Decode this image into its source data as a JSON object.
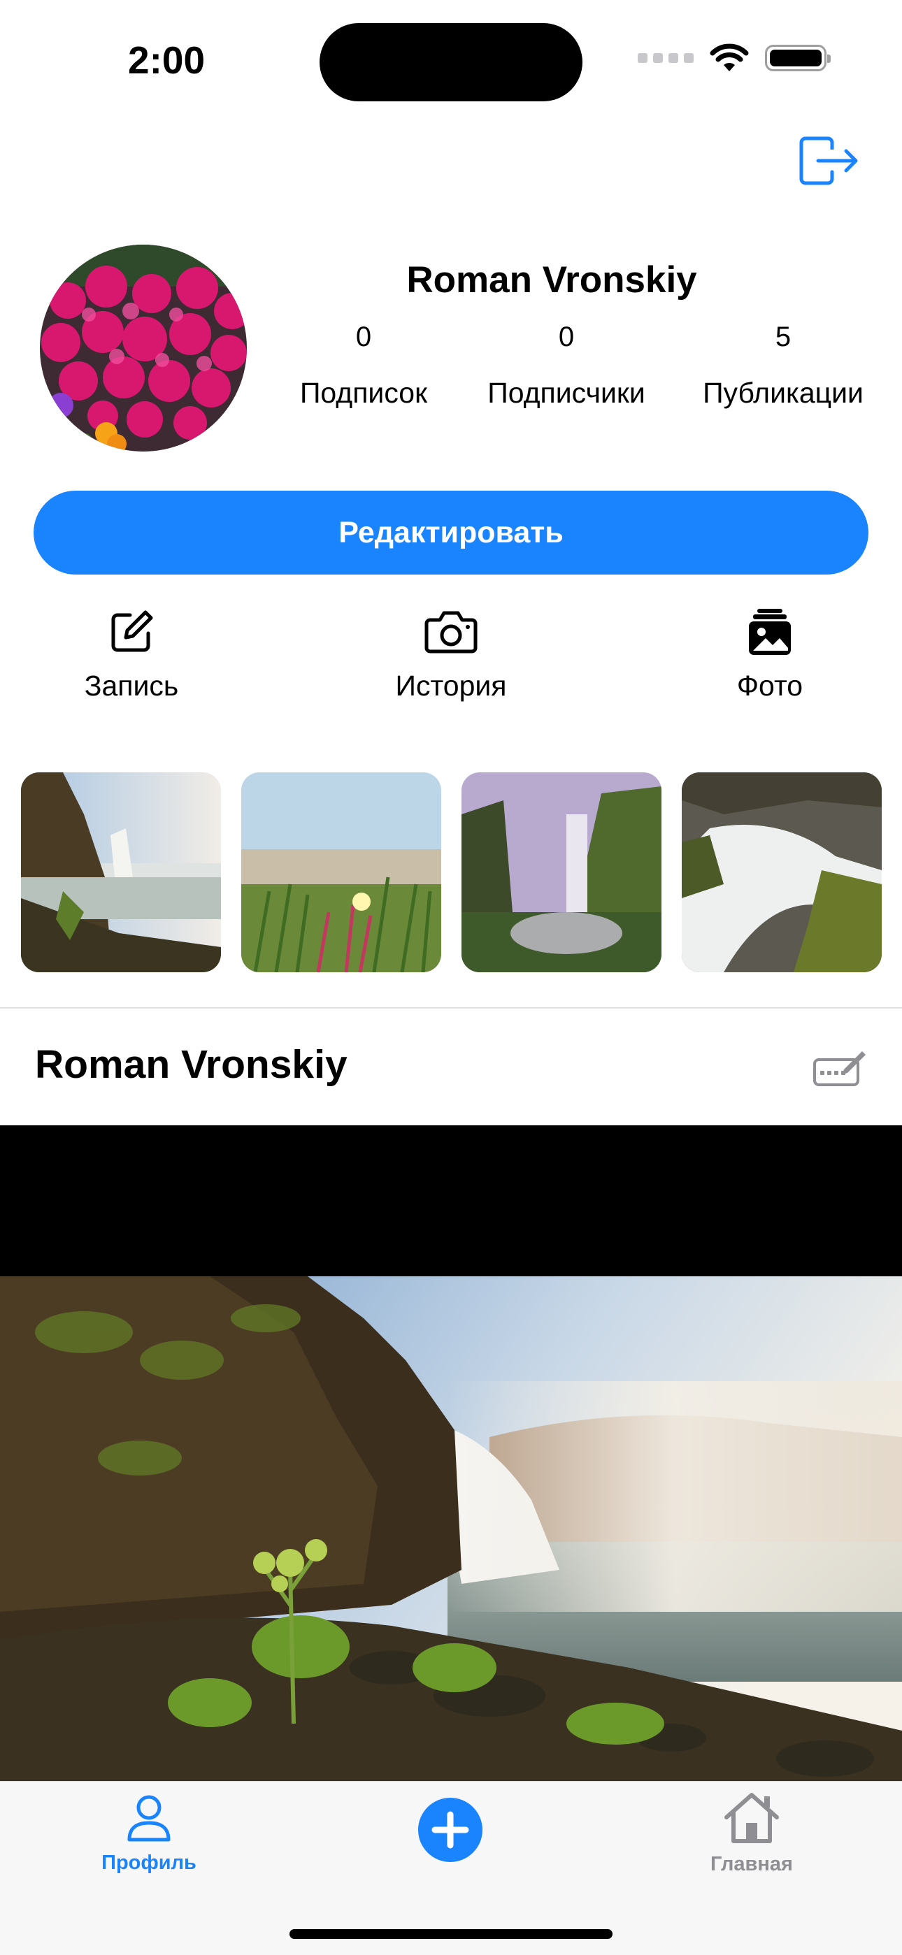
{
  "status_bar": {
    "time": "2:00"
  },
  "profile": {
    "name": "Roman Vronskiy",
    "stats": [
      {
        "value": "0",
        "label": "Подписок"
      },
      {
        "value": "0",
        "label": "Подписчики"
      },
      {
        "value": "5",
        "label": "Публикации"
      }
    ],
    "edit_label": "Редактировать"
  },
  "actions": [
    {
      "label": "Запись",
      "icon": "square-pencil-icon"
    },
    {
      "label": "История",
      "icon": "camera-icon"
    },
    {
      "label": "Фото",
      "icon": "photo-stack-icon"
    }
  ],
  "post": {
    "author": "Roman Vronskiy"
  },
  "tabbar": {
    "profile_label": "Профиль",
    "home_label": "Главная",
    "active_color": "#1a84ff",
    "inactive_color": "#8e8e93"
  },
  "colors": {
    "accent": "#1a84ff"
  }
}
